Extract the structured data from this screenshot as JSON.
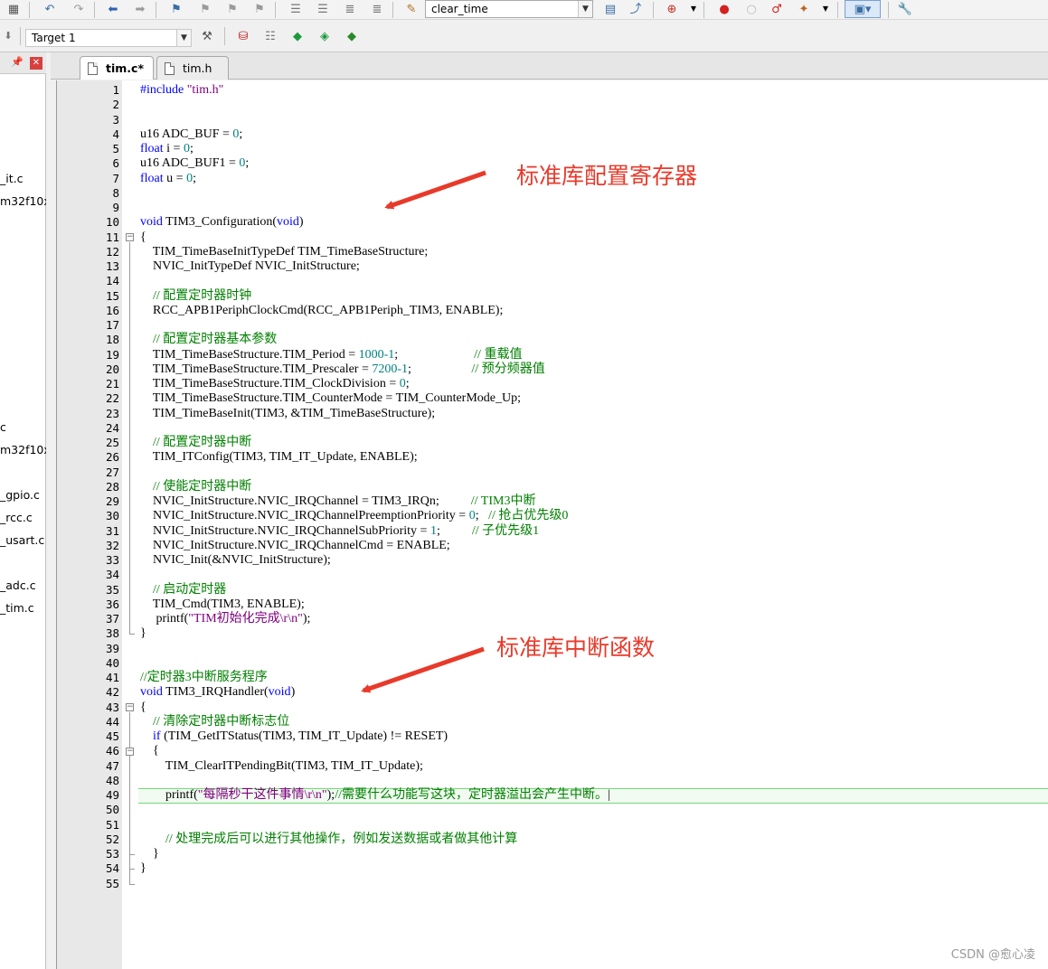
{
  "toolbar": {
    "function_combo_value": "clear_time",
    "target_combo_value": "Target 1"
  },
  "project_panel": {
    "items": [
      "_it.c",
      "m32f10x",
      "c",
      "m32f10x",
      "_gpio.c",
      "_rcc.c",
      "_usart.c",
      "_adc.c",
      "_tim.c"
    ]
  },
  "tabs": [
    {
      "label": "tim.c*",
      "active": true
    },
    {
      "label": "tim.h",
      "active": false
    }
  ],
  "annotations": {
    "first": "标准库配置寄存器",
    "second": "标准库中断函数",
    "color": "#e83a2a"
  },
  "watermark": "CSDN @愈心凌",
  "editor": {
    "highlighted_line": 49,
    "lines": [
      [
        [
          "pp",
          "#include "
        ],
        [
          "str",
          "\"tim.h\""
        ]
      ],
      [],
      [],
      [
        [
          "t",
          "u16 ADC_BUF = "
        ],
        [
          "num",
          "0"
        ],
        [
          "t",
          ";"
        ]
      ],
      [
        [
          "kw",
          "float"
        ],
        [
          "t",
          " i = "
        ],
        [
          "num",
          "0"
        ],
        [
          "t",
          ";"
        ]
      ],
      [
        [
          "t",
          "u16 ADC_BUF1 = "
        ],
        [
          "num",
          "0"
        ],
        [
          "t",
          ";"
        ]
      ],
      [
        [
          "kw",
          "float"
        ],
        [
          "t",
          " u = "
        ],
        [
          "num",
          "0"
        ],
        [
          "t",
          ";"
        ]
      ],
      [],
      [],
      [
        [
          "kw",
          "void"
        ],
        [
          "t",
          " TIM3_Configuration("
        ],
        [
          "kw",
          "void"
        ],
        [
          "t",
          ")"
        ]
      ],
      [
        [
          "t",
          "{"
        ]
      ],
      [
        [
          "t",
          "    TIM_TimeBaseInitTypeDef TIM_TimeBaseStructure;"
        ]
      ],
      [
        [
          "t",
          "    NVIC_InitTypeDef NVIC_InitStructure;"
        ]
      ],
      [],
      [
        [
          "cm",
          "    // 配置定时器时钟"
        ]
      ],
      [
        [
          "t",
          "    RCC_APB1PeriphClockCmd(RCC_APB1Periph_TIM3, ENABLE);"
        ]
      ],
      [],
      [
        [
          "cm",
          "    // 配置定时器基本参数"
        ]
      ],
      [
        [
          "t",
          "    TIM_TimeBaseStructure.TIM_Period = "
        ],
        [
          "num",
          "1000-1"
        ],
        [
          "t",
          ";                        "
        ],
        [
          "cm",
          "// 重载值"
        ]
      ],
      [
        [
          "t",
          "    TIM_TimeBaseStructure.TIM_Prescaler = "
        ],
        [
          "num",
          "7200-1"
        ],
        [
          "t",
          ";                   "
        ],
        [
          "cm",
          "// 预分频器值"
        ]
      ],
      [
        [
          "t",
          "    TIM_TimeBaseStructure.TIM_ClockDivision = "
        ],
        [
          "num",
          "0"
        ],
        [
          "t",
          ";"
        ]
      ],
      [
        [
          "t",
          "    TIM_TimeBaseStructure.TIM_CounterMode = TIM_CounterMode_Up;"
        ]
      ],
      [
        [
          "t",
          "    TIM_TimeBaseInit(TIM3, &TIM_TimeBaseStructure);"
        ]
      ],
      [],
      [
        [
          "cm",
          "    // 配置定时器中断"
        ]
      ],
      [
        [
          "t",
          "    TIM_ITConfig(TIM3, TIM_IT_Update, ENABLE);"
        ]
      ],
      [],
      [
        [
          "cm",
          "    // 使能定时器中断"
        ]
      ],
      [
        [
          "t",
          "    NVIC_InitStructure.NVIC_IRQChannel = TIM3_IRQn;          "
        ],
        [
          "cm",
          "// TIM3中断"
        ]
      ],
      [
        [
          "t",
          "    NVIC_InitStructure.NVIC_IRQChannelPreemptionPriority = "
        ],
        [
          "num",
          "0"
        ],
        [
          "t",
          ";   "
        ],
        [
          "cm",
          "// 抢占优先级0"
        ]
      ],
      [
        [
          "t",
          "    NVIC_InitStructure.NVIC_IRQChannelSubPriority = "
        ],
        [
          "num",
          "1"
        ],
        [
          "t",
          ";          "
        ],
        [
          "cm",
          "// 子优先级1"
        ]
      ],
      [
        [
          "t",
          "    NVIC_InitStructure.NVIC_IRQChannelCmd = ENABLE;"
        ]
      ],
      [
        [
          "t",
          "    NVIC_Init(&NVIC_InitStructure);"
        ]
      ],
      [],
      [
        [
          "cm",
          "    // 启动定时器"
        ]
      ],
      [
        [
          "t",
          "    TIM_Cmd(TIM3, ENABLE);"
        ]
      ],
      [
        [
          "t",
          "     printf("
        ],
        [
          "str",
          "\"TIM初始化完成\\r\\n\""
        ],
        [
          "t",
          ");"
        ]
      ],
      [
        [
          "t",
          "}"
        ]
      ],
      [],
      [],
      [
        [
          "cm",
          "//定时器3中断服务程序"
        ]
      ],
      [
        [
          "kw",
          "void"
        ],
        [
          "t",
          " TIM3_IRQHandler("
        ],
        [
          "kw",
          "void"
        ],
        [
          "t",
          ")"
        ]
      ],
      [
        [
          "t",
          "{"
        ]
      ],
      [
        [
          "cm",
          "    // 清除定时器中断标志位"
        ]
      ],
      [
        [
          "kw",
          "    if"
        ],
        [
          "t",
          " (TIM_GetITStatus(TIM3, TIM_IT_Update) != RESET)"
        ]
      ],
      [
        [
          "t",
          "    {"
        ]
      ],
      [
        [
          "t",
          "        TIM_ClearITPendingBit(TIM3, TIM_IT_Update);"
        ]
      ],
      [],
      [
        [
          "t",
          "        printf("
        ],
        [
          "str",
          "\"每隔秒干这件事情\\r\\n\""
        ],
        [
          "t",
          ");"
        ],
        [
          "cm",
          "//需要什么功能写这块，定时器溢出会产生中断。"
        ],
        [
          "t",
          "|"
        ]
      ],
      [],
      [],
      [
        [
          "cm",
          "        // 处理完成后可以进行其他操作，例如发送数据或者做其他计算"
        ]
      ],
      [
        [
          "t",
          "    }"
        ]
      ],
      [
        [
          "t",
          "}"
        ]
      ],
      []
    ]
  }
}
